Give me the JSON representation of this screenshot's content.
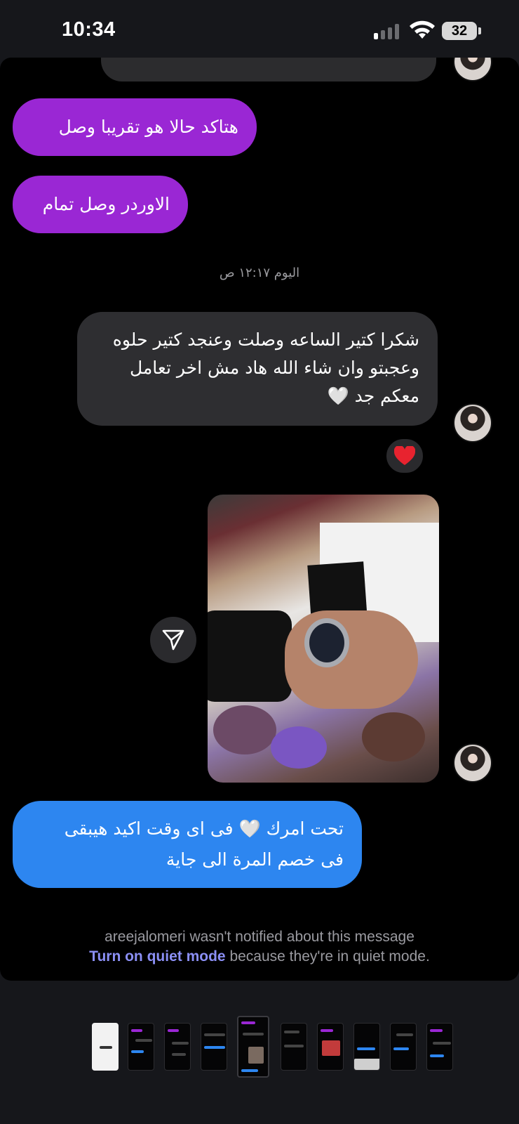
{
  "status_bar": {
    "time": "10:34",
    "battery": "32"
  },
  "conversation": {
    "sent_1": "هتاكد حالا هو تقريبا وصل",
    "sent_2": "الاوردر وصل تمام",
    "day_separator": "اليوم ١٢:١٧ ص",
    "received_1_text": "شكرا كتير الساعه وصلت وعنجد كتير حلوه وعجبتو وان شاء الله هاد مش اخر تعامل معكم جد",
    "received_1_emoji": "🤍",
    "reaction_emoji": "❤️",
    "reply_line_1_a": "تحت امرك",
    "reply_emoji": "🤍",
    "reply_line_1_b": "فى اى وقت اكيد هيبقى",
    "reply_line_2": "فى خصم المرة الى جاية"
  },
  "notice": {
    "line1": "areejalomeri wasn't notified about this message",
    "link": "Turn on quiet mode",
    "rest": " because they're in quiet mode."
  },
  "colors": {
    "sent_bubble": "#9a27d4",
    "received_bubble": "#2e2e31",
    "reply_bubble": "#2d86f0",
    "link": "#8b8ff5"
  },
  "icons": [
    "heart-icon",
    "share-icon",
    "wifi-icon",
    "signal-icon",
    "battery-icon"
  ]
}
